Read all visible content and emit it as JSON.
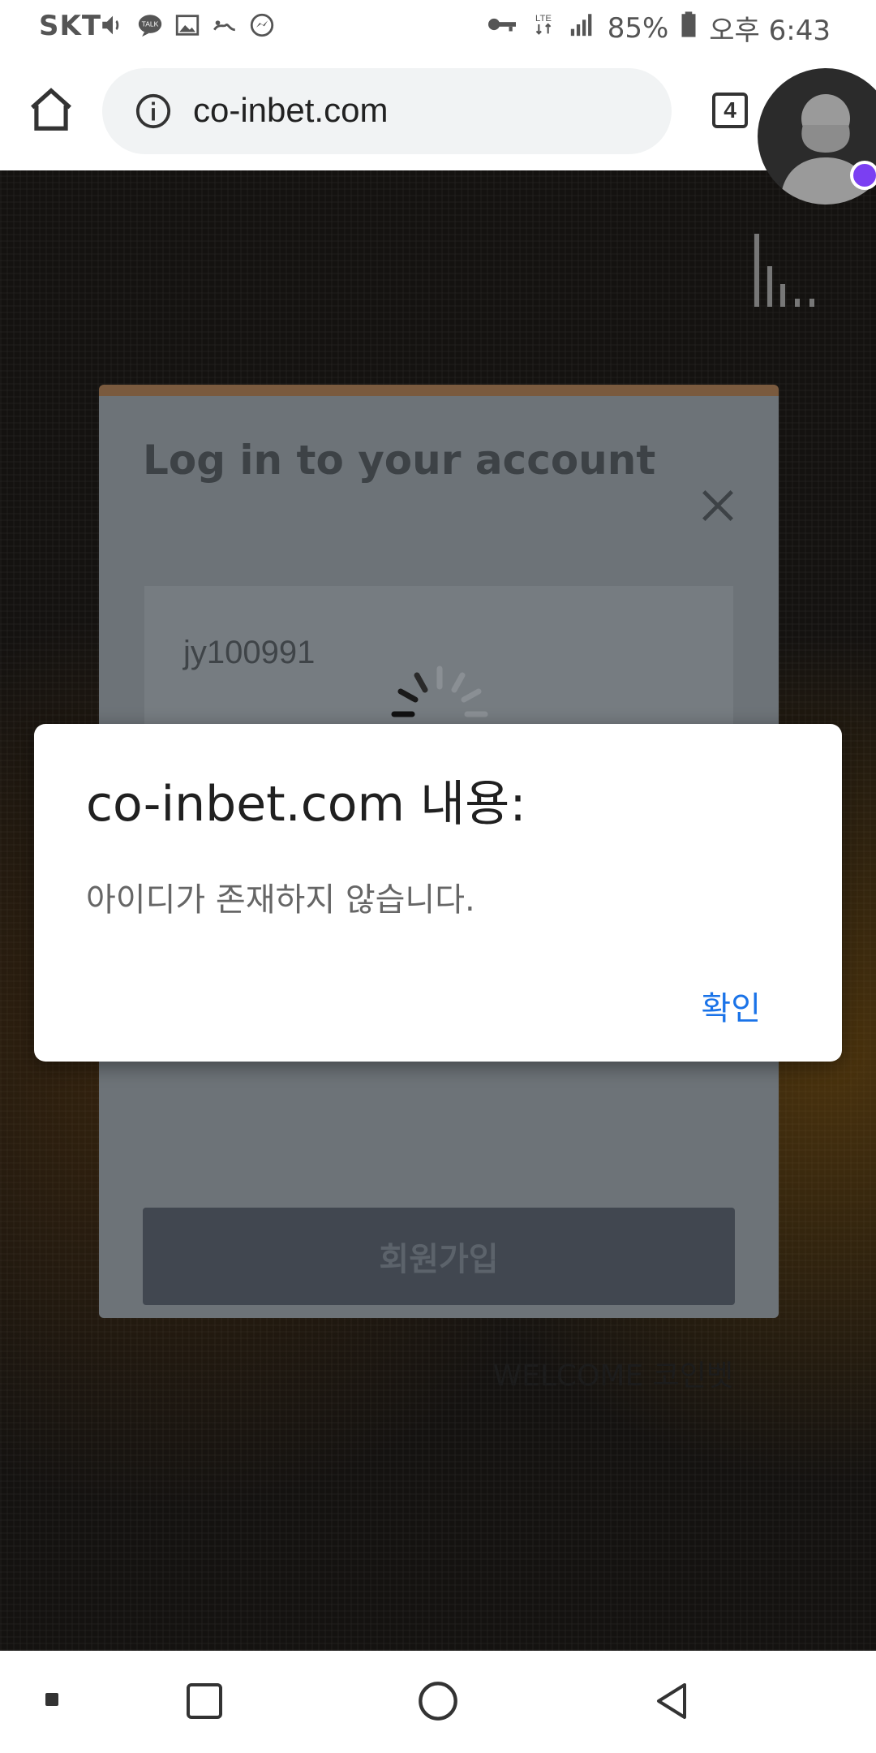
{
  "status_bar": {
    "carrier": "SKT",
    "battery": "85%",
    "time": "오후 6:43",
    "network": "LTE",
    "icons_left": [
      "volume-icon",
      "talk-icon",
      "gallery-icon",
      "app-icon",
      "messenger-icon"
    ],
    "icons_right": [
      "key-icon",
      "lte-icon",
      "signal-icon",
      "battery-icon"
    ]
  },
  "browser": {
    "url": "co-inbet.com",
    "tab_count": "4"
  },
  "login_modal": {
    "title": "Log in to your account",
    "id_value": "jy100991",
    "signup_label": "회원가입",
    "welcome": "WELCOME 코인벳"
  },
  "alert": {
    "title": "co-inbet.com 내용:",
    "message": "아이디가 존재하지 않습니다.",
    "ok_label": "확인"
  },
  "colors": {
    "accent_blue": "#1a73e8",
    "modal_top_border": "#7a5a3e",
    "avatar_badge": "#7b3ff2"
  }
}
